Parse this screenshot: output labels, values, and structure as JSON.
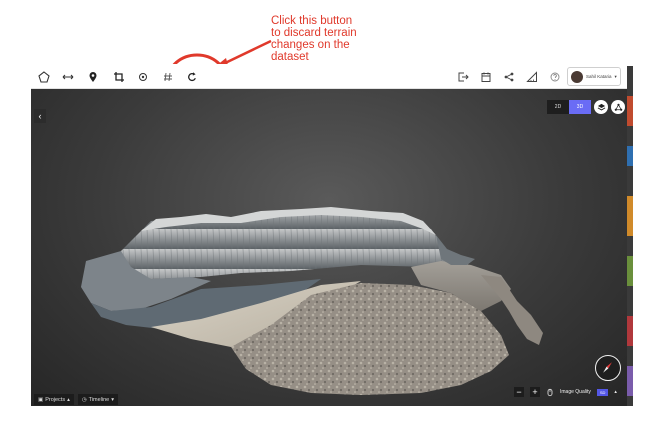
{
  "annotation": {
    "lines": [
      "Click this button",
      "to discard terrain",
      "changes on the",
      "dataset"
    ],
    "color": "#e0392b"
  },
  "toolbar": {
    "left_tools": [
      "polygon-icon",
      "measure-distance-icon",
      "location-pin-icon",
      "crop-icon",
      "target-icon",
      "hash-icon",
      "undo-discard-icon"
    ],
    "right_tools": [
      "export-icon",
      "calendar-icon",
      "share-icon",
      "ruler-icon",
      "help-icon"
    ],
    "user": {
      "name": "Sahil Kataria",
      "caret": "▾"
    }
  },
  "viewport": {
    "back_label": "‹",
    "view_modes": [
      "2D",
      "3D"
    ],
    "active_view_mode": "3D",
    "accent": "#6a6cf5",
    "bottom_left": {
      "projects_label": "Projects",
      "timeline_label": "Timeline"
    },
    "zoom_out_label": "−",
    "zoom_in_label": "+",
    "image_quality_label": "Image Quality",
    "image_quality_badge": "SD"
  }
}
